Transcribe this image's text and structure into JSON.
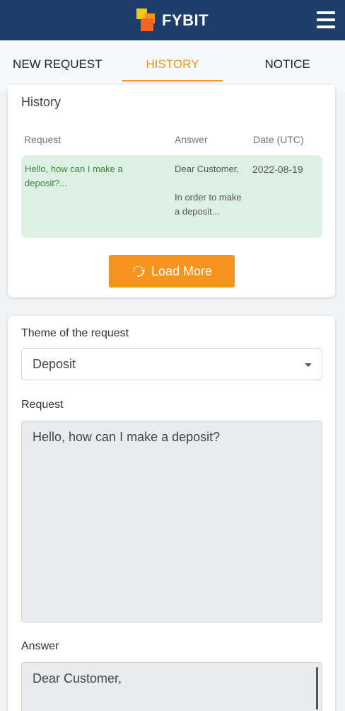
{
  "header": {
    "brand": "FYBIT",
    "menu_icon": "hamburger-icon"
  },
  "tabs": [
    {
      "label": "NEW REQUEST",
      "active": false
    },
    {
      "label": "HISTORY",
      "active": true
    },
    {
      "label": "NOTICE",
      "active": false
    }
  ],
  "history": {
    "title": "History",
    "columns": {
      "request": "Request",
      "answer": "Answer",
      "date": "Date (UTC)"
    },
    "rows": [
      {
        "request": "Hello, how can I make a deposit?...",
        "answer": "Dear Customer,\n\nIn order to make a deposit...",
        "date": "2022-08-19"
      }
    ],
    "load_more_label": "Load More",
    "load_more_icon": "refresh-icon"
  },
  "form": {
    "theme_label": "Theme of the request",
    "theme_value": "Deposit",
    "request_label": "Request",
    "request_value": "Hello, how can I make a deposit?",
    "answer_label": "Answer",
    "answer_value": "Dear Customer,"
  },
  "colors": {
    "navbar": "#1d3d6b",
    "accent": "#f7941d",
    "row_highlight": "#ddf0e4"
  }
}
